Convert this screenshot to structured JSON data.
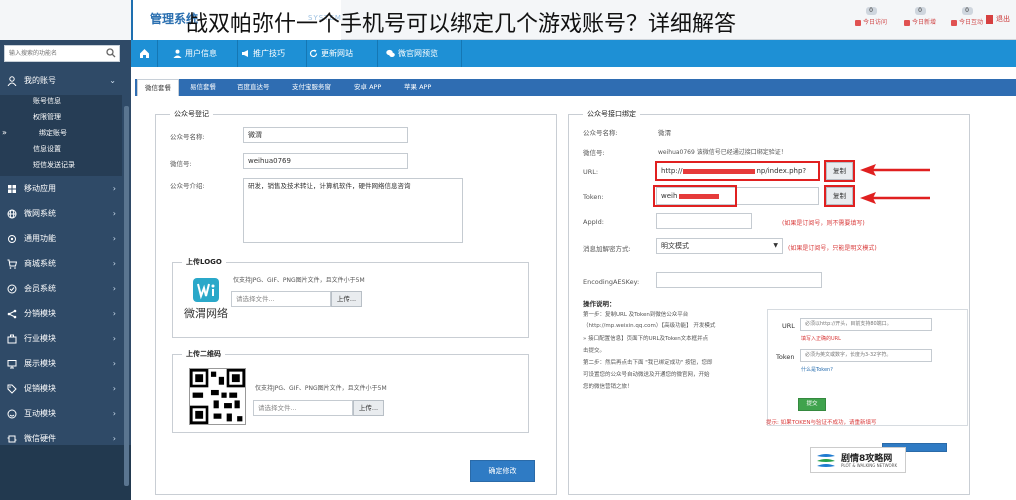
{
  "overlay_title": "战双帕弥什一个手机号可以绑定几个游戏账号？详细解答",
  "header": {
    "brand": "管理系统",
    "brand_sub": "SYSTEM",
    "tools": [
      {
        "badge": "0",
        "label": "今日访问"
      },
      {
        "badge": "0",
        "label": "今日新增"
      },
      {
        "badge": "0",
        "label": "今日互动"
      }
    ],
    "exit_label": "退出"
  },
  "sidebar": {
    "search_placeholder": "输入搜索的功能名",
    "items": [
      {
        "label": "我的账号",
        "icon": "user-icon"
      },
      {
        "label": "移动应用",
        "icon": "apps-icon"
      },
      {
        "label": "微网系统",
        "icon": "globe-icon"
      },
      {
        "label": "通用功能",
        "icon": "gear-icon"
      },
      {
        "label": "商城系统",
        "icon": "cart-icon"
      },
      {
        "label": "会员系统",
        "icon": "member-icon"
      },
      {
        "label": "分销模块",
        "icon": "share-icon"
      },
      {
        "label": "行业模块",
        "icon": "industry-icon"
      },
      {
        "label": "展示模块",
        "icon": "display-icon"
      },
      {
        "label": "促销模块",
        "icon": "tag-icon"
      },
      {
        "label": "互动模块",
        "icon": "interact-icon"
      },
      {
        "label": "微信硬件",
        "icon": "hardware-icon"
      }
    ],
    "subitems": [
      "账号信息",
      "权限管理",
      "绑定账号",
      "信息设置",
      "短信发送记录"
    ]
  },
  "navbar": {
    "items": [
      "用户信息",
      "推广技巧",
      "更新网站",
      "微官网预览"
    ]
  },
  "tabs": [
    "微信套餐",
    "易信套餐",
    "百度直达号",
    "支付宝服务窗",
    "安卓 APP",
    "苹果 APP"
  ],
  "left_panel": {
    "legend": "公众号登记",
    "name_label": "公众号名称:",
    "name_value": "微渭",
    "wx_label": "微信号:",
    "wx_value": "weihua0769",
    "intro_label": "公众号介绍:",
    "intro_value": "研发，销售及技术转让，计算机软件，硬件网络信息咨询",
    "logo_legend": "上传LOGO",
    "logo_hint": "仅支持JPG、GIF、PNG图片文件，且文件小于5M",
    "logo_placeholder": "请选择文件...",
    "logo_upload": "上传...",
    "logo_brand": "微渭网络",
    "qr_legend": "上传二维码",
    "qr_hint": "仅支持JPG、GIF、PNG图片文件，且文件小于5M",
    "qr_placeholder": "请选择文件...",
    "qr_upload": "上传...",
    "confirm": "确定修改"
  },
  "right_panel": {
    "legend": "公众号接口绑定",
    "name_label": "公众号名称:",
    "name_value": "微渭",
    "wx_label": "微信号:",
    "wx_value": "weihua0769 该微信号已经通过接口绑定验证！",
    "url_label": "URL:",
    "url_prefix": "http://",
    "url_suffix": "np/index.php?",
    "copy": "复制",
    "token_label": "Token:",
    "token_value": "weih",
    "appid_label": "AppId:",
    "appid_note": "(如果是订阅号，则不需要填写)",
    "secret_label": "消息加解密方式:",
    "secret_value": "明文模式",
    "secret_note": "(如果是订阅号，只能是明文模式)",
    "aes_label": "EncodingAESKey:",
    "op_title": "操作说明：",
    "op_lines": [
      "第一步：复制URL 及Token到微信公众平台",
      "（http://mp.weixin.qq.com）【高级功能】 开发模式",
      "» 接口配置信息】页面下的URL及Token文本框并点",
      "击提交。",
      "第二步：然后再点击下面 \"我已绑定成功\" 按钮，您即",
      "可设置您的公众号自动微送及开通您的微官网，开始",
      "您的微信营销之旅！"
    ],
    "guide_url_label": "URL",
    "guide_url_text": "必须以http://开头，目前支持80端口。",
    "guide_url_link": "填写入正确的URL",
    "guide_token_label": "Token",
    "guide_token_text": "必须为英文或数字，长度为3-32字符。",
    "guide_token_link": "什么是Token?",
    "guide_submit": "提交",
    "verify_note": "提示: 如果TOKEN与验证不成功，请重新填写"
  },
  "watermark": {
    "title": "剧情8攻略网",
    "sub": "PLOT & WALKING NETWORK"
  },
  "colors": {
    "sidebar_bg": "#2f4a67",
    "navbar_bg": "#1e90d5",
    "tab_bg": "#2f6db2",
    "highlight_red": "#e02020",
    "primary_button": "#2f7bc4"
  }
}
